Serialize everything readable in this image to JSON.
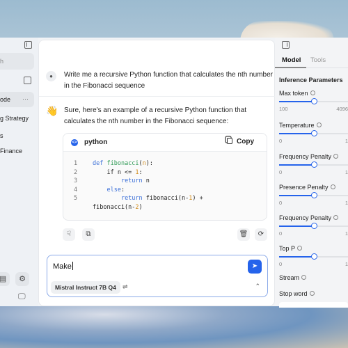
{
  "left_sidebar": {
    "search_placeholder": "h",
    "threads": [
      {
        "label": "ode",
        "active": true
      },
      {
        "label": "g Strategy",
        "active": false
      },
      {
        "label": "s",
        "active": false
      },
      {
        "label": "Finance",
        "active": false
      }
    ],
    "more_label": "···"
  },
  "chat": {
    "user_message": "Write me a recursive Python function that calculates the nth number in the Fibonacci sequence",
    "assistant_emoji": "👋",
    "assistant_message": "Sure, here's an example of a recursive Python function that calculates the nth number in the Fibonacci sequence:",
    "code_block": {
      "language": "python",
      "copy_label": "Copy",
      "line_numbers": [
        "1",
        "2",
        "3",
        "4",
        "5"
      ]
    },
    "input": {
      "value": "Make",
      "model": "Mistral Instruct 7B Q4"
    }
  },
  "right_panel": {
    "tabs": [
      {
        "label": "Model",
        "active": true
      },
      {
        "label": "Tools",
        "active": false
      }
    ],
    "section_title": "Inference Parameters",
    "params": [
      {
        "label": "Max token",
        "min": "100",
        "max": "4096",
        "value_fraction": 0.5
      },
      {
        "label": "Temperature",
        "min": "0",
        "max": "1",
        "value_fraction": 0.5
      },
      {
        "label": "Frequency Penalty",
        "min": "0",
        "max": "1",
        "value_fraction": 0.5
      },
      {
        "label": "Presence Penalty",
        "min": "0",
        "max": "1",
        "value_fraction": 0.5
      },
      {
        "label": "Frequency Penalty",
        "min": "0",
        "max": "1",
        "value_fraction": 0.5
      },
      {
        "label": "Top P",
        "min": "0",
        "max": "1",
        "value_fraction": 0.5
      }
    ],
    "stream_label": "Stream",
    "stop_word_label": "Stop word"
  }
}
